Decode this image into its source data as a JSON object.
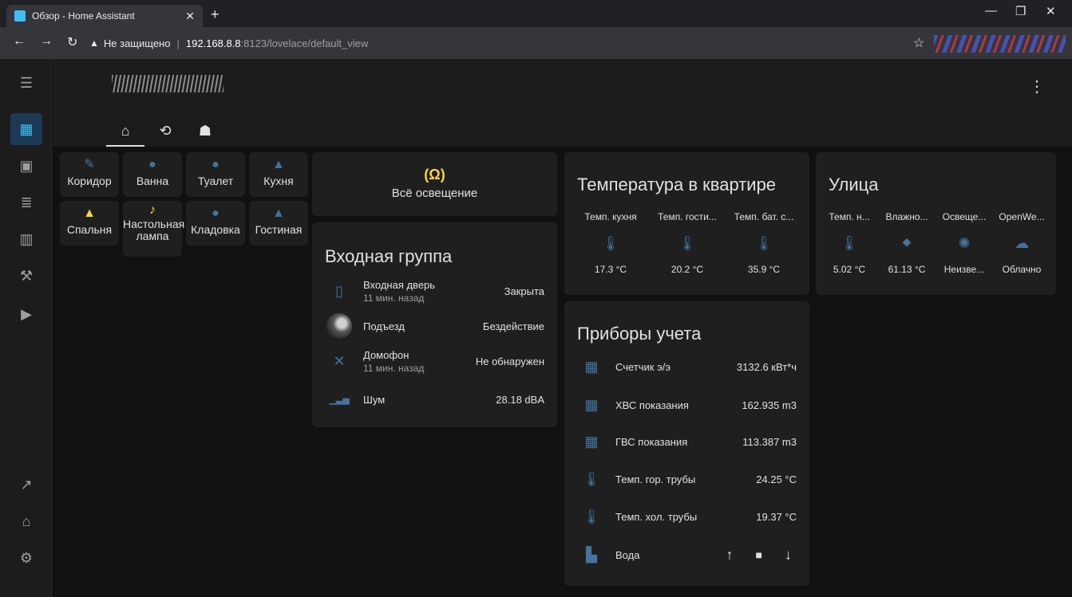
{
  "browser": {
    "tab_title": "Обзор - Home Assistant",
    "security_label": "Не защищено",
    "url_host": "192.168.8.8",
    "url_path": ":8123/lovelace/default_view"
  },
  "header": {
    "views": [
      {
        "icon": "home-outline-icon",
        "glyph": "⌂"
      },
      {
        "icon": "history-icon",
        "glyph": "⟲"
      },
      {
        "icon": "robot-icon",
        "glyph": "☗"
      }
    ]
  },
  "rooms": [
    {
      "label": "Коридор",
      "icon": "led-strip-icon",
      "glyph": "✎",
      "color": "#44739e"
    },
    {
      "label": "Ванна",
      "icon": "lightbulb-icon",
      "glyph": "●",
      "color": "#44739e"
    },
    {
      "label": "Туалет",
      "icon": "lightbulb-icon",
      "glyph": "●",
      "color": "#44739e"
    },
    {
      "label": "Кухня",
      "icon": "ceiling-light-icon",
      "glyph": "▲",
      "color": "#44739e"
    },
    {
      "label": "Спальня",
      "icon": "ceiling-light-icon",
      "glyph": "▲",
      "color": "#fdd835"
    },
    {
      "label": "Настольная лампа",
      "icon": "desk-lamp-icon",
      "glyph": "♪",
      "color": "#fdd835"
    },
    {
      "label": "Кладовка",
      "icon": "lightbulb-icon",
      "glyph": "●",
      "color": "#44739e"
    },
    {
      "label": "Гостиная",
      "icon": "ceiling-light-icon",
      "glyph": "▲",
      "color": "#44739e"
    }
  ],
  "all_lights": {
    "label": "Всё освещение",
    "icon": "lightbulb-group-icon",
    "color": "#fdd835"
  },
  "entrance": {
    "title": "Входная группа",
    "rows": [
      {
        "name": "Входная дверь",
        "sub": "11 мин. назад",
        "value": "Закрыта",
        "icon": "door-closed-icon",
        "glyph": "▯"
      },
      {
        "name": "Подъезд",
        "sub": "",
        "value": "Бездействие",
        "icon": "camera-avatar-icon",
        "glyph": "◐"
      },
      {
        "name": "Домофон",
        "sub": "11 мин. назад",
        "value": "Не обнаружен",
        "icon": "bell-off-icon",
        "glyph": "✕"
      },
      {
        "name": "Шум",
        "sub": "",
        "value": "28.18 dBA",
        "icon": "soundcloud-icon",
        "glyph": "▁▃▅"
      }
    ]
  },
  "temperature": {
    "title": "Температура в квартире",
    "items": [
      {
        "name": "Темп. кухня",
        "value": "17.3 °C",
        "icon": "thermometer-icon"
      },
      {
        "name": "Темп. гости...",
        "value": "20.2 °C",
        "icon": "thermometer-icon"
      },
      {
        "name": "Темп. бат. с...",
        "value": "35.9 °C",
        "icon": "thermometer-icon"
      }
    ]
  },
  "street": {
    "title": "Улица",
    "items": [
      {
        "name": "Темп. н...",
        "value": "5.02 °C",
        "icon": "thermometer-icon",
        "glyph": "🌡"
      },
      {
        "name": "Влажно...",
        "value": "61.13 °C",
        "icon": "water-percent-icon",
        "glyph": "◆"
      },
      {
        "name": "Освеще...",
        "value": "Неизве...",
        "icon": "brightness-icon",
        "glyph": "✺"
      },
      {
        "name": "OpenWe...",
        "value": "Облачно",
        "icon": "cloud-icon",
        "glyph": "☁"
      }
    ]
  },
  "meters": {
    "title": "Приборы учета",
    "rows": [
      {
        "name": "Счетчик э/э",
        "value": "3132.6 кВт*ч",
        "icon": "counter-icon",
        "glyph": "▦"
      },
      {
        "name": "ХВС показания",
        "value": "162.935 m3",
        "icon": "counter-icon",
        "glyph": "▦"
      },
      {
        "name": "ГВС показания",
        "value": "113.387 m3",
        "icon": "counter-icon",
        "glyph": "▦"
      },
      {
        "name": "Темп. гор. трубы",
        "value": "24.25 °C",
        "icon": "thermometer-icon",
        "glyph": "🌡"
      },
      {
        "name": "Темп. хол. трубы",
        "value": "19.37 °C",
        "icon": "thermometer-icon",
        "glyph": "🌡"
      }
    ],
    "water": {
      "name": "Вода",
      "icon": "water-pump-icon"
    }
  }
}
